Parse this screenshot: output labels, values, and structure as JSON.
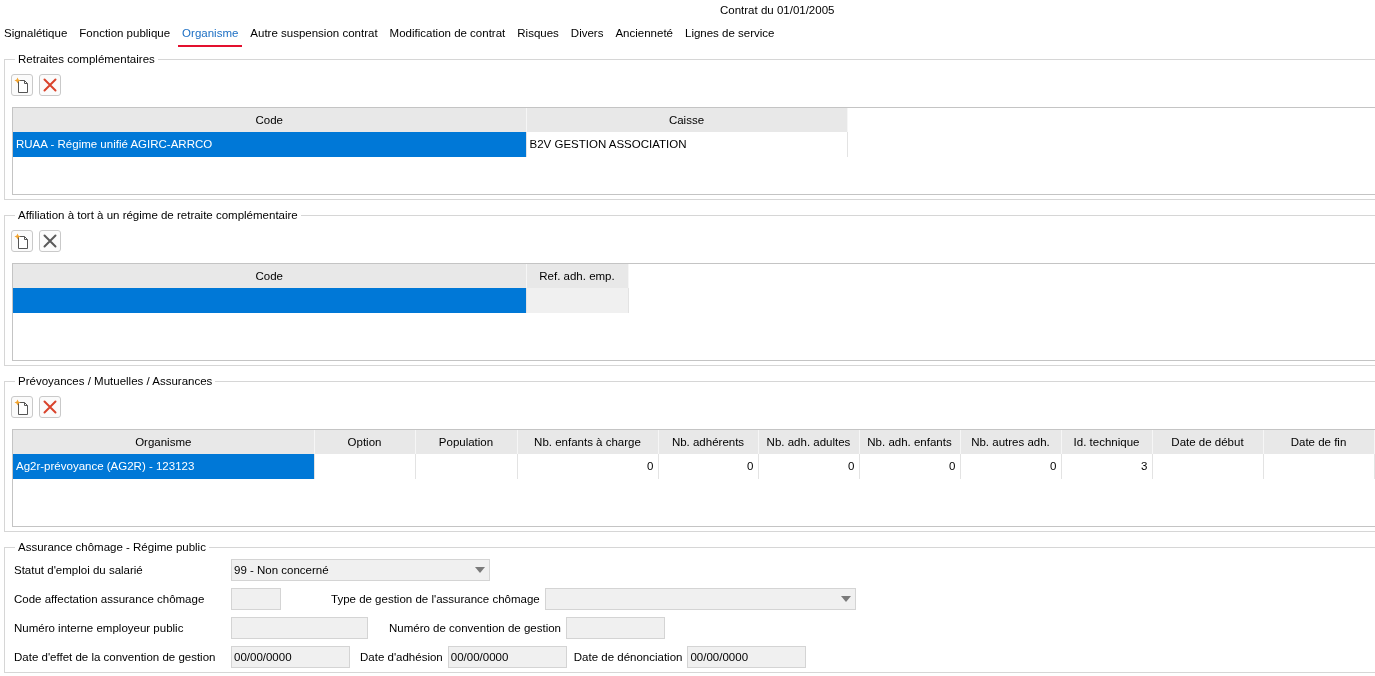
{
  "title": "Contrat du 01/01/2005",
  "tabs": [
    {
      "label": "Signalétique",
      "selected": false
    },
    {
      "label": "Fonction publique",
      "selected": false
    },
    {
      "label": "Organisme",
      "selected": true
    },
    {
      "label": "Autre suspension contrat",
      "selected": false
    },
    {
      "label": "Modification de contrat",
      "selected": false
    },
    {
      "label": "Risques",
      "selected": false
    },
    {
      "label": "Divers",
      "selected": false
    },
    {
      "label": "Ancienneté",
      "selected": false
    },
    {
      "label": "Lignes de service",
      "selected": false
    }
  ],
  "sections": [
    {
      "title": "Retraites complémentaires",
      "toolbar": [
        {
          "kind": "new",
          "disabled": false
        },
        {
          "kind": "delete",
          "disabled": false
        }
      ],
      "table": {
        "columns": [
          {
            "label": "Code",
            "kind": "text"
          },
          {
            "label": "Caisse",
            "kind": "text"
          }
        ],
        "rows": [
          {
            "selected": true,
            "cells": [
              "RUAA - Régime unifié AGIRC-ARRCO",
              "B2V GESTION ASSOCIATION"
            ]
          }
        ]
      }
    },
    {
      "title": "Affiliation à tort à un régime de retraite complémentaire",
      "toolbar": [
        {
          "kind": "new",
          "disabled": false
        },
        {
          "kind": "delete",
          "disabled": true
        }
      ],
      "table": {
        "columns": [
          {
            "label": "Code",
            "kind": "text",
            "readonly": false
          },
          {
            "label": "Ref. adh. emp.",
            "kind": "text",
            "readonly": true
          }
        ],
        "rows": [
          {
            "selected": true,
            "cells": [
              null,
              null
            ]
          }
        ]
      }
    },
    {
      "title": "Prévoyances / Mutuelles / Assurances",
      "toolbar": [
        {
          "kind": "new",
          "disabled": false
        },
        {
          "kind": "delete",
          "disabled": false
        }
      ],
      "table": {
        "columns": [
          {
            "label": "Organisme",
            "kind": "text"
          },
          {
            "label": "Option",
            "kind": "text"
          },
          {
            "label": "Population",
            "kind": "text"
          },
          {
            "label": "Nb. enfants à charge",
            "kind": "number"
          },
          {
            "label": "Nb. adhérents",
            "kind": "number"
          },
          {
            "label": "Nb. adh. adultes",
            "kind": "number"
          },
          {
            "label": "Nb. adh. enfants",
            "kind": "number"
          },
          {
            "label": "Nb. autres adh.",
            "kind": "number"
          },
          {
            "label": "Id. technique",
            "kind": "number"
          },
          {
            "label": "Date de début",
            "kind": "text"
          },
          {
            "label": "Date de fin",
            "kind": "text"
          }
        ],
        "rows": [
          {
            "selected": true,
            "cells": [
              "Ag2r-prévoyance (AG2R) - 123123",
              null,
              null,
              "0",
              "0",
              "0",
              "0",
              "0",
              "3",
              null,
              null
            ]
          }
        ]
      }
    }
  ],
  "unemployment": {
    "title": "Assurance chômage - Régime public",
    "rows": [
      [
        {
          "label": "Statut d'emploi du salarié",
          "kind": "select",
          "value": "99 - Non concerné",
          "disabled": true
        }
      ],
      [
        {
          "label": "Code affectation assurance chômage",
          "kind": "input",
          "disabled": true
        },
        {
          "label": "Type de gestion de l'assurance chômage",
          "kind": "select",
          "disabled": true
        }
      ],
      [
        {
          "label": "Numéro interne employeur public",
          "kind": "input",
          "disabled": true
        },
        {
          "label": "Numéro de convention de gestion",
          "kind": "input",
          "disabled": true
        }
      ],
      [
        {
          "label": "Date d'effet de la convention de gestion",
          "kind": "input",
          "value": "00/00/0000",
          "disabled": true
        },
        {
          "label": "Date d'adhésion",
          "kind": "input",
          "value": "00/00/0000",
          "disabled": true
        },
        {
          "label": "Date de dénonciation",
          "kind": "input",
          "value": "00/00/0000",
          "disabled": true
        }
      ]
    ]
  }
}
